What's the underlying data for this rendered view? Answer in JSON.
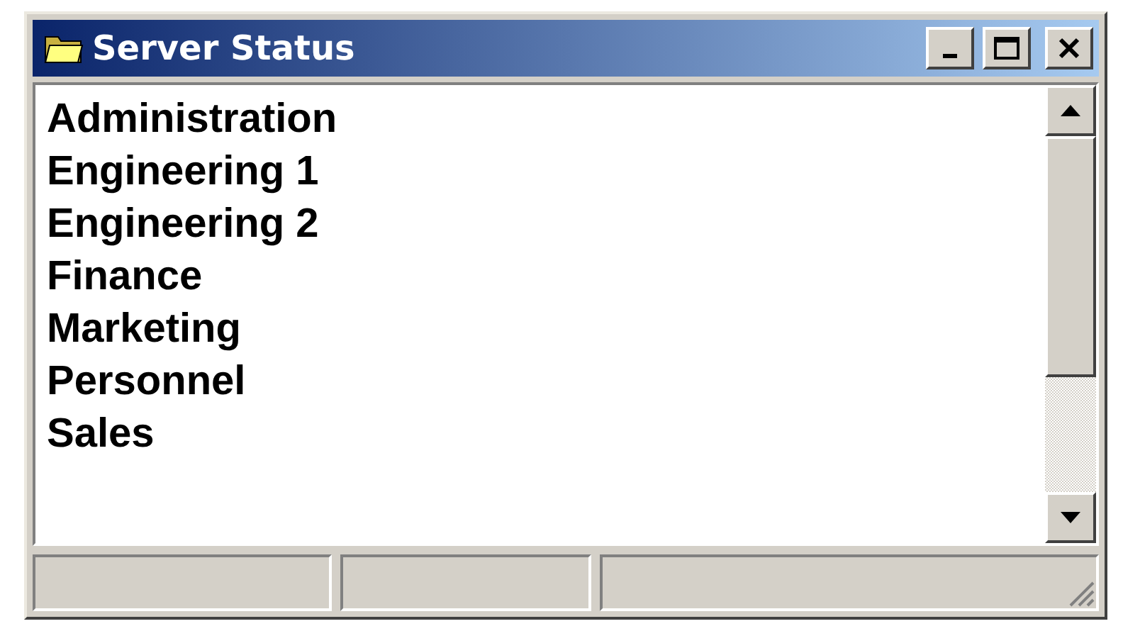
{
  "window": {
    "title": "Server Status"
  },
  "list": {
    "items": [
      "Administration",
      "Engineering 1",
      "Engineering 2",
      "Finance",
      "Marketing",
      "Personnel",
      "Sales"
    ]
  }
}
